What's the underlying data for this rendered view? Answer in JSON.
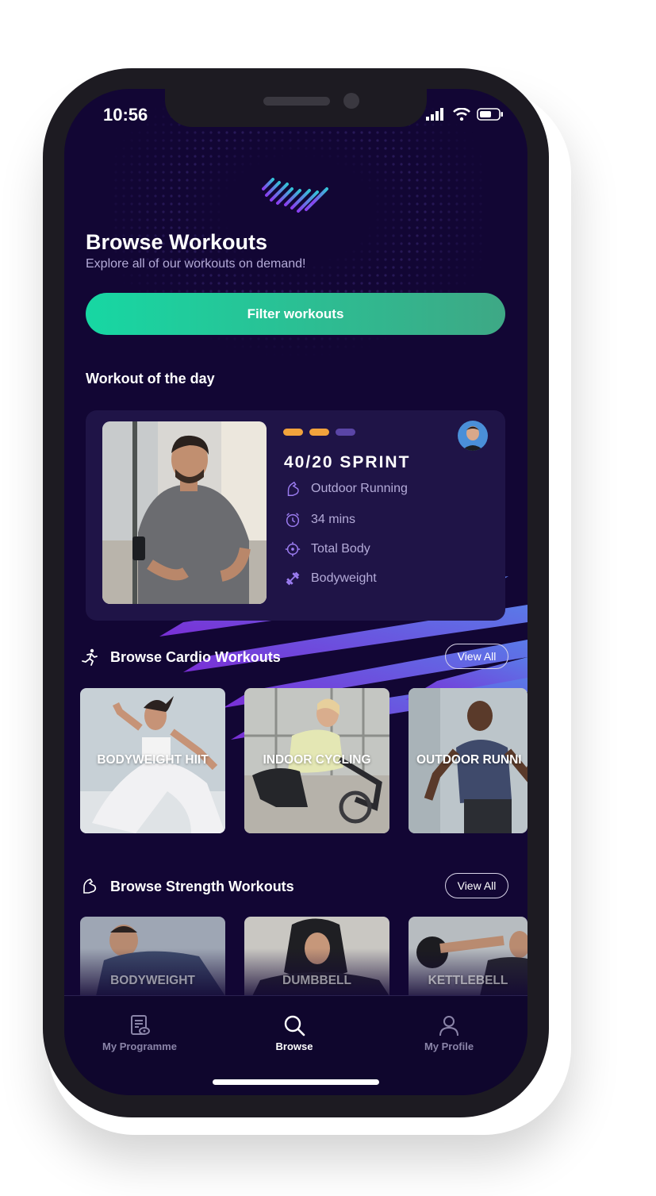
{
  "status_bar": {
    "time": "10:56"
  },
  "header": {
    "title": "Browse Workouts",
    "subtitle": "Explore all of our workouts on demand!",
    "filter_label": "Filter workouts"
  },
  "workout_of_day": {
    "section_title": "Workout of the day",
    "name": "40/20 SPRINT",
    "intensity_level": 2,
    "intensity_max": 3,
    "details": [
      {
        "icon": "arm-muscle-icon",
        "text": "Outdoor Running"
      },
      {
        "icon": "alarm-clock-icon",
        "text": "34 mins"
      },
      {
        "icon": "target-icon",
        "text": "Total Body"
      },
      {
        "icon": "dumbbell-icon",
        "text": "Bodyweight"
      }
    ],
    "colors": {
      "level_on": "#f2a33c",
      "level_off": "#5a45a6"
    }
  },
  "cardio": {
    "title": "Browse Cardio Workouts",
    "view_all": "View All",
    "tiles": [
      "BODYWEIGHT HIIT",
      "INDOOR CYCLING",
      "OUTDOOR RUNNI"
    ]
  },
  "strength": {
    "title": "Browse Strength Workouts",
    "view_all": "View All",
    "tiles": [
      "BODYWEIGHT",
      "DUMBBELL",
      "KETTLEBELL"
    ]
  },
  "nav": {
    "items": [
      {
        "label": "My Programme",
        "icon": "programme-icon",
        "active": false
      },
      {
        "label": "Browse",
        "icon": "search-icon",
        "active": true
      },
      {
        "label": "My Profile",
        "icon": "profile-icon",
        "active": false
      }
    ]
  },
  "colors": {
    "background": "#120634",
    "card": "#1f1447",
    "accent_start": "#17d7a3",
    "accent_end": "#3ea885",
    "stripe": "#8a3df0"
  }
}
